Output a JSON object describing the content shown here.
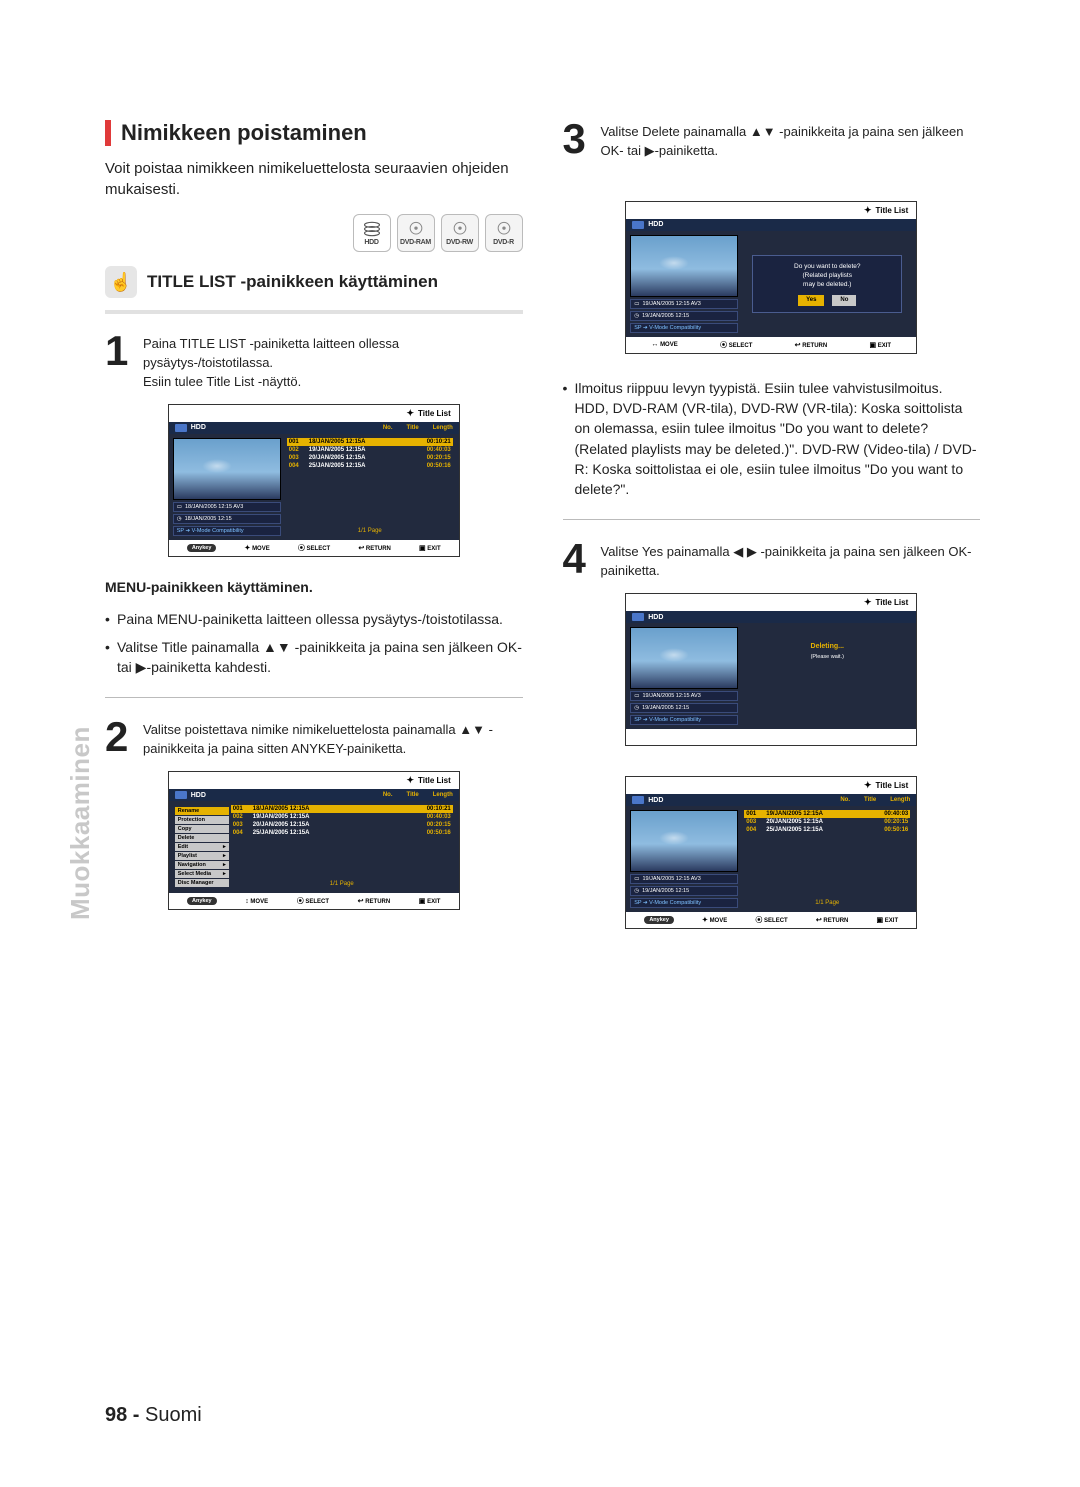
{
  "sideTab": "Muokkaaminen",
  "footer_page": "98 -",
  "footer_lang": "Suomi",
  "leftCol": {
    "sectionTitle": "Nimikkeen poistaminen",
    "intro": "Voit poistaa nimikkeen nimikeluettelosta seuraavien ohjeiden mukaisesti.",
    "badges": {
      "hdd": "HDD",
      "ram": "DVD-RAM",
      "rw": "DVD-RW",
      "r": "DVD-R"
    },
    "subheading": "TITLE LIST -painikkeen käyttäminen",
    "step1": {
      "num": "1",
      "lines": [
        "Paina TITLE LIST -painiketta laitteen ollessa pysäytys-/toistotilassa.",
        "Esiin tulee Title List -näyttö."
      ]
    },
    "menuHeading": "MENU-painikkeen käyttäminen.",
    "menuBullets": [
      "Paina MENU-painiketta laitteen ollessa pysäytys-/toistotilassa.",
      "Valitse Title painamalla ▲▼ -painikkeita ja paina sen jälkeen OK- tai ▶-painiketta kahdesti."
    ],
    "step2": {
      "num": "2",
      "text": "Valitse poistettava nimike nimikeluettelosta painamalla ▲▼ -painikkeita ja paina sitten ANYKEY-painiketta."
    },
    "menuItems": [
      "Rename",
      "Protection",
      "Copy",
      "Delete",
      "Edit",
      "Playlist",
      "Navigation",
      "Select Media",
      "Disc Manager"
    ]
  },
  "rightCol": {
    "step3": {
      "num": "3",
      "text": "Valitse Delete painamalla ▲▼ -painikkeita ja paina sen jälkeen OK- tai ▶-painiketta."
    },
    "dialog": {
      "line1": "Do you want to delete?",
      "line2": "(Related playlists",
      "line3": "may be deleted.)",
      "yes": "Yes",
      "no": "No"
    },
    "note": "Ilmoitus riippuu levyn tyypistä. Esiin tulee vahvistusilmoitus. HDD, DVD-RAM (VR-tila), DVD-RW (VR-tila): Koska soittolista on olemassa, esiin tulee ilmoitus \"Do you want to delete? (Related playlists may be deleted.)\". DVD-RW (Video-tila) / DVD-R: Koska soittolistaa ei ole, esiin tulee ilmoitus \"Do you want to delete?\".",
    "step4": {
      "num": "4",
      "text": "Valitse Yes painamalla ◀ ▶ -painikkeita ja paina sen jälkeen OK-painiketta."
    },
    "deleting": "Deleting...",
    "pleaseWait": "(Please wait.)"
  },
  "tv": {
    "titleList": "Title List",
    "hdd": "HDD",
    "colNo": "No.",
    "colTitle": "Title",
    "colLen": "Length",
    "rows": [
      {
        "no": "001",
        "title": "18/JAN/2005 12:15A",
        "len": "00:10:21"
      },
      {
        "no": "002",
        "title": "19/JAN/2005 12:15A",
        "len": "00:40:03"
      },
      {
        "no": "003",
        "title": "20/JAN/2005 12:15A",
        "len": "00:20:15"
      },
      {
        "no": "004",
        "title": "25/JAN/2005 12:15A",
        "len": "00:50:16"
      }
    ],
    "rowsAfter": [
      {
        "no": "001",
        "title": "19/JAN/2005 12:15A",
        "len": "00:40:03"
      },
      {
        "no": "003",
        "title": "20/JAN/2005 12:15A",
        "len": "00:20:15"
      },
      {
        "no": "004",
        "title": "25/JAN/2005 12:15A",
        "len": "00:50:16"
      }
    ],
    "meta1": "18/JAN/2005 12:15 AV3",
    "meta1b": "19/JAN/2005 12:15 AV3",
    "meta2_a": "18/JAN/2005 12:15",
    "meta2_b": "19/JAN/2005 12:15",
    "meta3": "SP ➔ V-Mode Compatibility",
    "pageInd": "1/1 Page",
    "foot_anykey": "Anykey",
    "foot_move": "MOVE",
    "foot_select": "SELECT",
    "foot_return": "RETURN",
    "foot_exit": "EXIT"
  }
}
